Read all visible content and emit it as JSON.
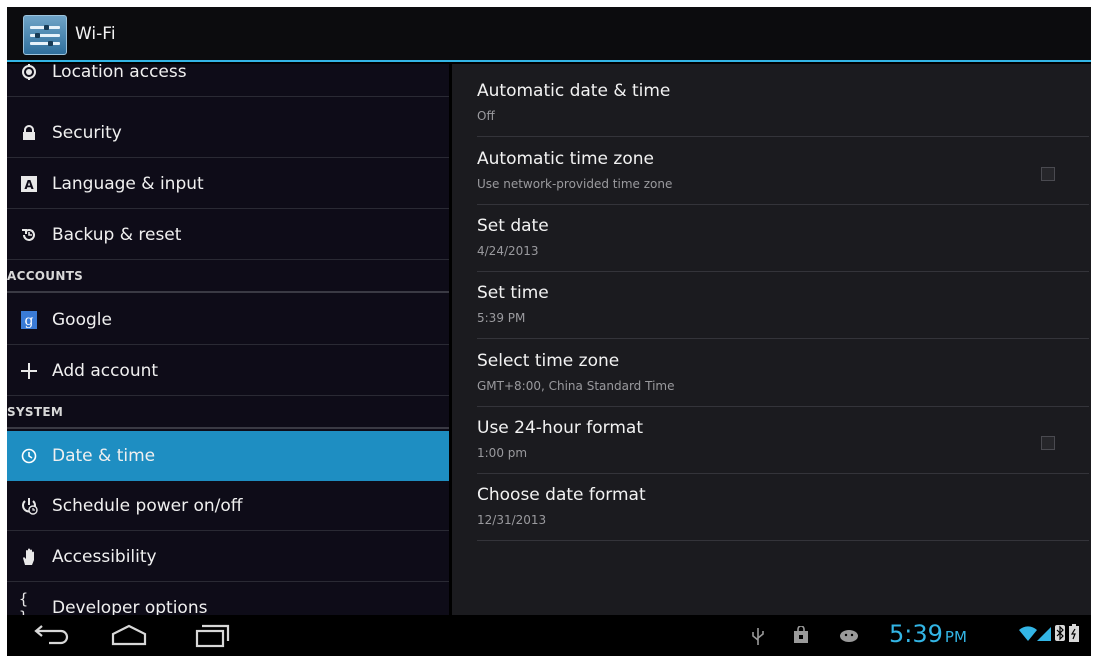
{
  "action_bar": {
    "title": "Wi-Fi"
  },
  "sidebar": {
    "items_top": [
      {
        "label": "Location access",
        "icon": "location-icon"
      },
      {
        "label": "Security",
        "icon": "lock-icon"
      },
      {
        "label": "Language & input",
        "icon": "keyboard-a-icon"
      },
      {
        "label": "Backup & reset",
        "icon": "restore-icon"
      }
    ],
    "header_accounts": "ACCOUNTS",
    "accounts": [
      {
        "label": "Google",
        "icon": "google-icon"
      },
      {
        "label": "Add account",
        "icon": "plus-icon"
      }
    ],
    "header_system": "SYSTEM",
    "system": [
      {
        "label": "Date & time",
        "icon": "clock-icon",
        "selected": true
      },
      {
        "label": "Schedule power on/off",
        "icon": "power-schedule-icon"
      },
      {
        "label": "Accessibility",
        "icon": "hand-icon"
      },
      {
        "label": "Developer options",
        "icon": "braces-icon"
      }
    ]
  },
  "settings": [
    {
      "title": "Automatic date & time",
      "summary": "Off",
      "checkbox": false
    },
    {
      "title": "Automatic time zone",
      "summary": "Use network-provided time zone",
      "checkbox": true,
      "checked": false
    },
    {
      "title": "Set date",
      "summary": "4/24/2013",
      "checkbox": false
    },
    {
      "title": "Set time",
      "summary": "5:39 PM",
      "checkbox": false
    },
    {
      "title": "Select time zone",
      "summary": "GMT+8:00, China Standard Time",
      "checkbox": false
    },
    {
      "title": "Use 24-hour format",
      "summary": "1:00 pm",
      "checkbox": true,
      "checked": false
    },
    {
      "title": "Choose date format",
      "summary": "12/31/2013",
      "checkbox": false
    }
  ],
  "navbar": {
    "buttons": [
      "back-icon",
      "home-icon",
      "recent-apps-icon"
    ],
    "status_icons": [
      "usb-icon",
      "bag-icon",
      "android-icon",
      "wifi-icon",
      "signal-icon",
      "bluetooth-icon",
      "battery-icon"
    ],
    "time": "5:39",
    "ampm": "PM"
  },
  "colors": {
    "accent": "#33b5e5",
    "selected": "#1e8ec2"
  }
}
